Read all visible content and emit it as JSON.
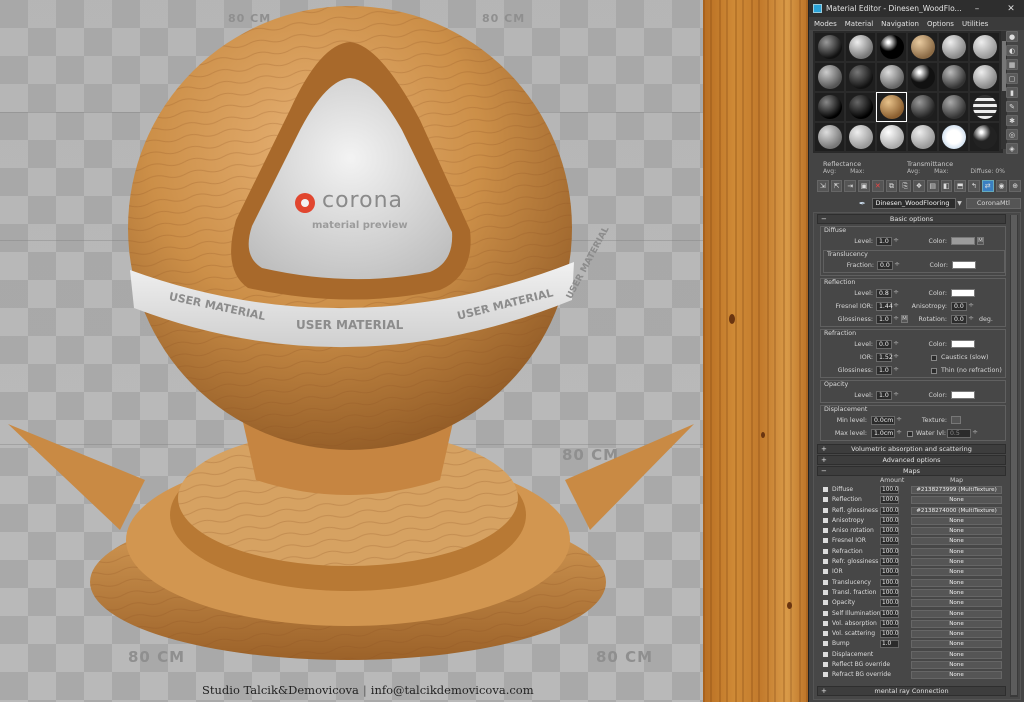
{
  "render": {
    "dimension_labels": [
      "80 CM",
      "80 CM",
      "80 CM",
      "80 CM",
      "80 CM",
      "80 CM",
      "80 CM"
    ],
    "preview_logo_text": "corona",
    "preview_subtitle": "material preview",
    "band_text": [
      "USER MATERIAL",
      "USER MATERIAL",
      "USER MATERIAL",
      "USER MATERIAL"
    ],
    "credit_studio": "Studio Talcik&Demovicova",
    "credit_sep": "|",
    "credit_email": "info@talcikdemovicova.com"
  },
  "editor": {
    "title": "Material Editor - Dinesen_WoodFlo...",
    "menu": [
      "Modes",
      "Material",
      "Navigation",
      "Options",
      "Utilities"
    ],
    "reflectance_label": "Reflectance",
    "reflectance_avg": "Avg:",
    "reflectance_max": "Max:",
    "transmittance_label": "Transmittance",
    "transmittance_avg": "Avg:",
    "transmittance_max": "Max:",
    "diffuse_label": "Diffuse:",
    "diffuse_value": "0%",
    "material_name": "Dinesen_WoodFlooring",
    "material_type": "CoronaMtl",
    "basic_options": "Basic options",
    "diffuse": {
      "title": "Diffuse",
      "level_label": "Level:",
      "level": "1.0",
      "color_label": "Color:",
      "m": "M",
      "translucency_title": "Translucency",
      "fraction_label": "Fraction:",
      "fraction": "0.0",
      "color2_label": "Color:"
    },
    "reflection": {
      "title": "Reflection",
      "level_label": "Level:",
      "level": "0.8",
      "color_label": "Color:",
      "ior_label": "Fresnel IOR:",
      "ior": "1.44",
      "aniso_label": "Anisotropy:",
      "aniso": "0.0",
      "gloss_label": "Glossiness:",
      "gloss": "1.0",
      "m": "M",
      "rot_label": "Rotation:",
      "rot": "0.0",
      "deg": "deg."
    },
    "refraction": {
      "title": "Refraction",
      "level_label": "Level:",
      "level": "0.0",
      "color_label": "Color:",
      "ior_label": "IOR:",
      "ior": "1.52",
      "caustics_label": "Caustics (slow)",
      "gloss_label": "Glossiness:",
      "gloss": "1.0",
      "thin_label": "Thin (no refraction)"
    },
    "opacity": {
      "title": "Opacity",
      "level_label": "Level:",
      "level": "1.0",
      "color_label": "Color:"
    },
    "displacement": {
      "title": "Displacement",
      "min_label": "Min level:",
      "min": "0.0cm",
      "texture_label": "Texture:",
      "max_label": "Max level:",
      "max": "1.0cm",
      "water_label": "Water lvl:",
      "water": "0.5"
    },
    "rollouts": [
      "Volumetric absorption and scattering",
      "Advanced options"
    ],
    "maps_title": "Maps",
    "maps_col_amount": "Amount",
    "maps_col_map": "Map",
    "maps": [
      {
        "name": "Diffuse",
        "amount": "100.0",
        "map": "#2138273999 (MultiTexture)"
      },
      {
        "name": "Reflection",
        "amount": "100.0",
        "map": "None"
      },
      {
        "name": "Refl. glossiness",
        "amount": "100.0",
        "map": "#2138274000 (MultiTexture)"
      },
      {
        "name": "Anisotropy",
        "amount": "100.0",
        "map": "None"
      },
      {
        "name": "Aniso rotation",
        "amount": "100.0",
        "map": "None"
      },
      {
        "name": "Fresnel IOR",
        "amount": "100.0",
        "map": "None"
      },
      {
        "name": "Refraction",
        "amount": "100.0",
        "map": "None"
      },
      {
        "name": "Refr. glossiness",
        "amount": "100.0",
        "map": "None"
      },
      {
        "name": "IOR",
        "amount": "100.0",
        "map": "None"
      },
      {
        "name": "Translucency",
        "amount": "100.0",
        "map": "None"
      },
      {
        "name": "Transl. fraction",
        "amount": "100.0",
        "map": "None"
      },
      {
        "name": "Opacity",
        "amount": "100.0",
        "map": "None"
      },
      {
        "name": "Self Illumination",
        "amount": "100.0",
        "map": "None"
      },
      {
        "name": "Vol. absorption",
        "amount": "100.0",
        "map": "None"
      },
      {
        "name": "Vol. scattering",
        "amount": "100.0",
        "map": "None"
      },
      {
        "name": "Bump",
        "amount": "1.0",
        "map": "None"
      },
      {
        "name": "Displacement",
        "amount": "",
        "map": "None"
      },
      {
        "name": "Reflect BG override",
        "amount": "",
        "map": "None"
      },
      {
        "name": "Refract BG override",
        "amount": "",
        "map": "None"
      }
    ],
    "mental_ray": "mental ray Connection",
    "colors": {
      "accent": "#3a7fc1",
      "wood": "#c98a3e",
      "panel_bg": "#474747"
    }
  }
}
